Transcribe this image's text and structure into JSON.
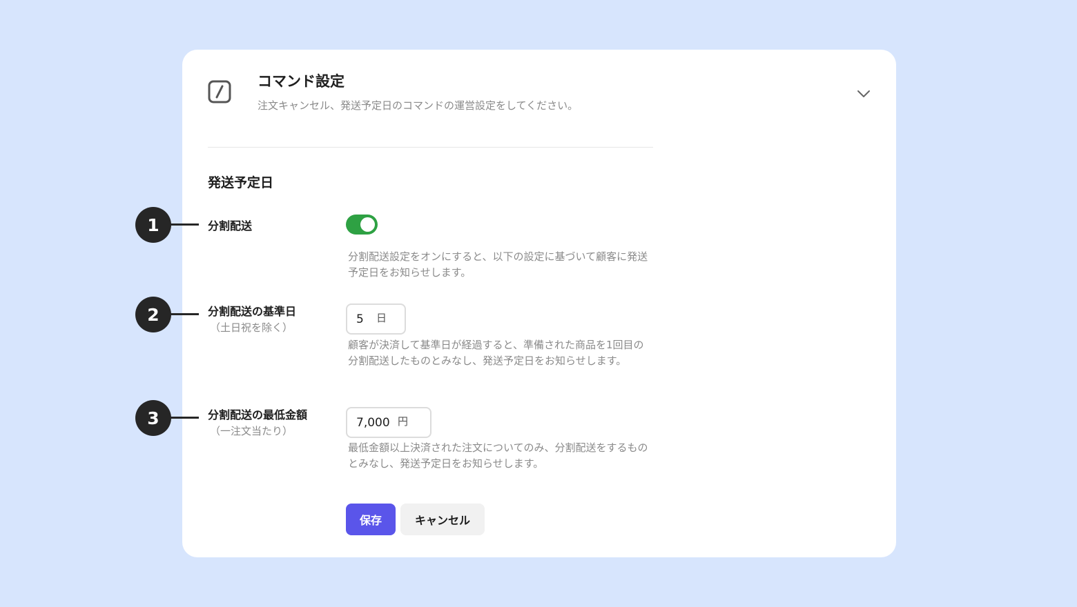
{
  "header": {
    "icon": "slash-command-icon",
    "title": "コマンド設定",
    "description": "注文キャンセル、発送予定日のコマンドの運営設定をしてください。",
    "collapse_icon": "chevron-down-icon"
  },
  "section": {
    "title": "発送予定日"
  },
  "settings": {
    "split_shipping": {
      "label": "分割配送",
      "enabled": true,
      "help": "分割配送設定をオンにすると、以下の設定に基づいて顧客に発送予定日をお知らせします。"
    },
    "base_days": {
      "label": "分割配送の基準日",
      "sublabel": "（土日祝を除く）",
      "value": "5",
      "unit": "日",
      "help": "顧客が決済して基準日が経過すると、準備された商品を1回目の分割配送したものとみなし、発送予定日をお知らせします。"
    },
    "min_amount": {
      "label": "分割配送の最低金額",
      "sublabel": "（一注文当たり）",
      "value": "7,000",
      "unit": "円",
      "help": "最低金額以上決済された注文についてのみ、分割配送をするものとみなし、発送予定日をお知らせします。"
    }
  },
  "actions": {
    "save_label": "保存",
    "cancel_label": "キャンセル"
  },
  "callouts": [
    "1",
    "2",
    "3"
  ],
  "colors": {
    "background": "#d7e5fd",
    "toggle_on": "#2ea143",
    "primary": "#5a55ea",
    "callout": "#262626"
  }
}
